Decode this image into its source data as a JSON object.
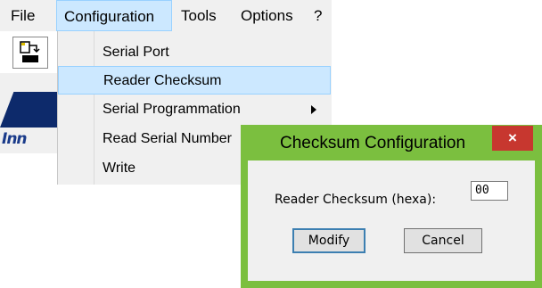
{
  "menubar": {
    "items": [
      {
        "label": "File"
      },
      {
        "label": "Configuration"
      },
      {
        "label": "Tools"
      },
      {
        "label": "Options"
      },
      {
        "label": "?"
      }
    ]
  },
  "configuration_menu": {
    "items": [
      {
        "label": "Serial Port"
      },
      {
        "label": "Reader Checksum"
      },
      {
        "label": "Serial Programmation"
      },
      {
        "label": "Read Serial Number"
      },
      {
        "label": "Write"
      }
    ]
  },
  "app": {
    "logo_text": "Inn"
  },
  "dialog": {
    "title": "Checksum Configuration",
    "close_glyph": "×",
    "field_label": "Reader Checksum (hexa):",
    "field_value": "00",
    "modify_label": "Modify",
    "cancel_label": "Cancel"
  },
  "colors": {
    "dialog_frame": "#7bbf3f",
    "close_button": "#c7372f",
    "menu_highlight": "#cce8ff"
  }
}
